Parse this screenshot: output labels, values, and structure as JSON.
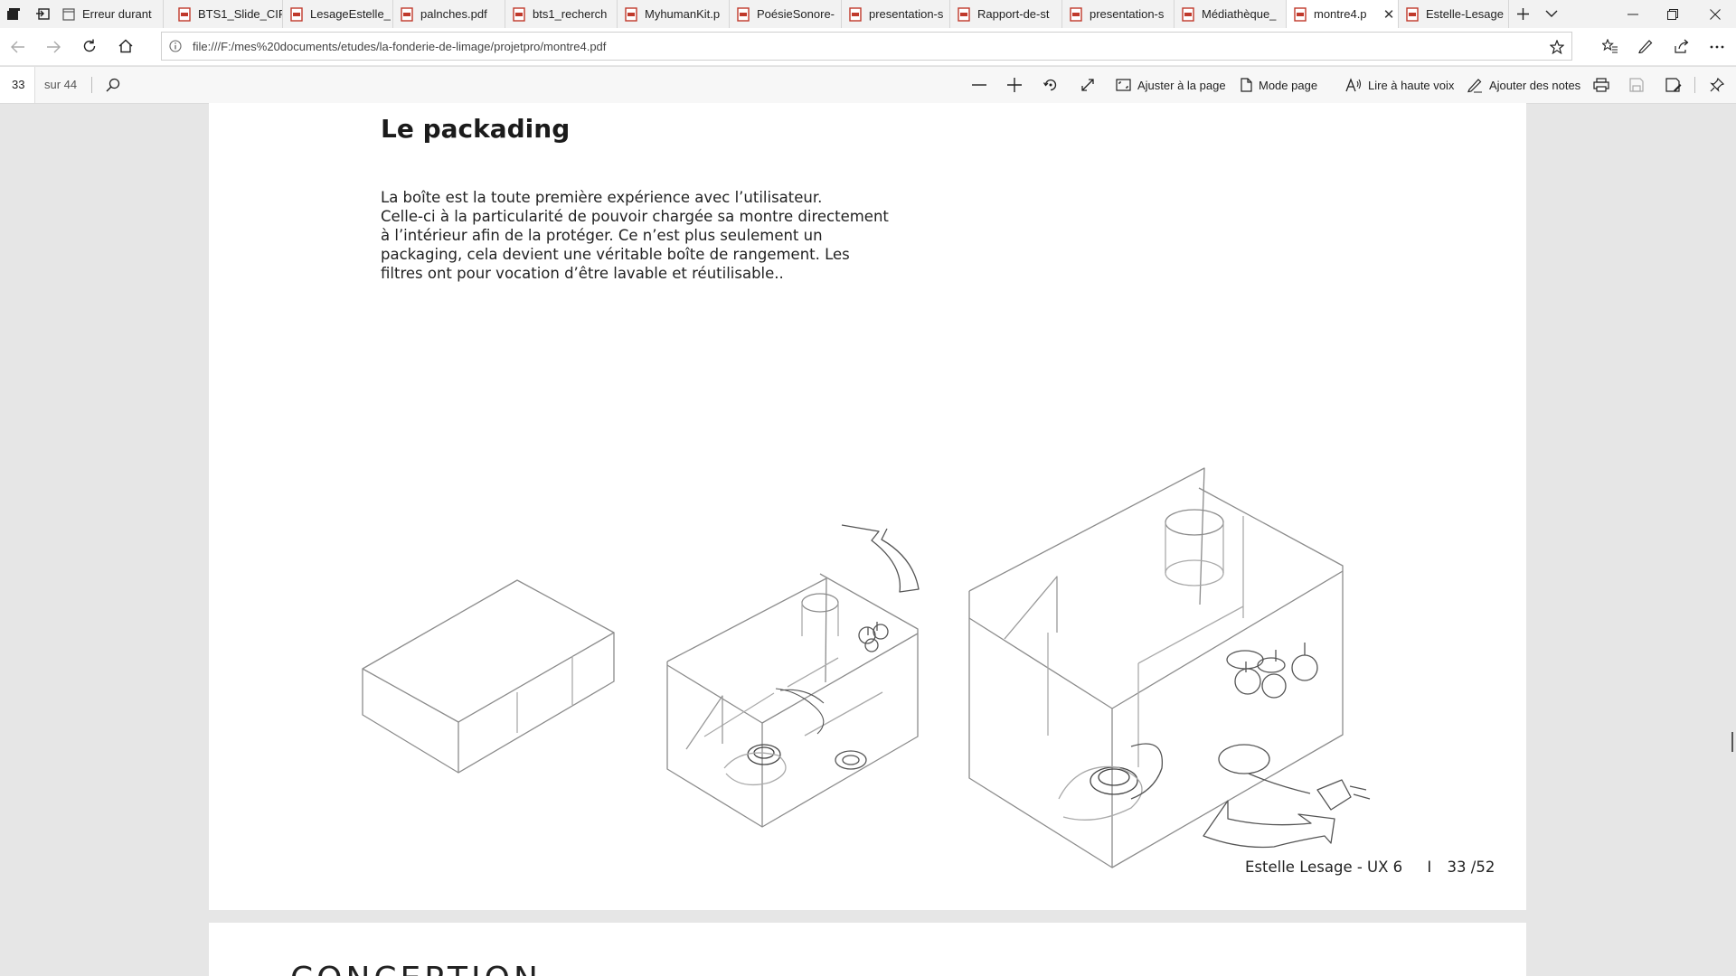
{
  "tabs": [
    {
      "label": "Erreur durant"
    },
    {
      "label": "BTS1_Slide_CIR"
    },
    {
      "label": "LesageEstelle_"
    },
    {
      "label": "palnches.pdf"
    },
    {
      "label": "bts1_recherch"
    },
    {
      "label": "MyhumanKit.p"
    },
    {
      "label": "PoésieSonore-"
    },
    {
      "label": "presentation-s"
    },
    {
      "label": "Rapport-de-st"
    },
    {
      "label": "presentation-s"
    },
    {
      "label": "Médiathèque_"
    },
    {
      "label": "montre4.p"
    },
    {
      "label": "Estelle-Lesage"
    }
  ],
  "address": {
    "url": "file:///F:/mes%20documents/etudes/la-fonderie-de-limage/projetpro/montre4.pdf"
  },
  "pdf_toolbar": {
    "page_number": "33",
    "page_total": "sur 44",
    "fit_page": "Ajuster à la page",
    "page_mode": "Mode page",
    "read_aloud": "Lire à haute voix",
    "add_notes": "Ajouter des notes"
  },
  "document": {
    "heading": "Le packading",
    "paragraph_lines": [
      "La boîte est la toute première expérience avec l’utilisateur.",
      "Celle-ci à la particularité de pouvoir chargée sa montre directement",
      "à l’intérieur afin de la protéger. Ce n’est plus seulement un",
      "packaging, cela devient une véritable boîte de rangement. Les",
      "filtres ont pour vocation d’être lavable et réutilisable.."
    ],
    "footer_author": "Estelle Lesage - UX 6",
    "footer_sep": "I",
    "footer_page": "33 /52",
    "next_page_heading": "CONCEPTION"
  }
}
